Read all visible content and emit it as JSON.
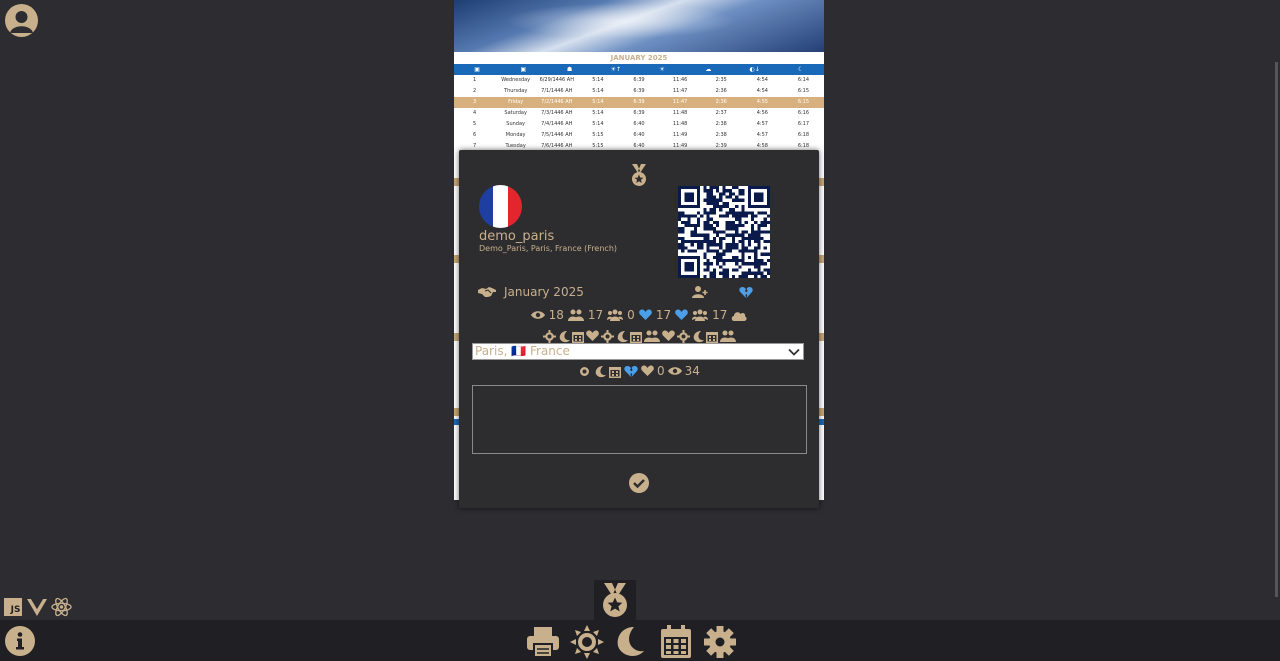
{
  "calendar": {
    "month_title": "JANUARY 2025",
    "headers": [
      "▣",
      "▣",
      "☗",
      "☀↑",
      "☀",
      "☁",
      "◐↓",
      "☾"
    ],
    "rows": [
      [
        "1",
        "Wednesday",
        "6/29/1446 AH",
        "5:14",
        "6:39",
        "11:46",
        "2:35",
        "4:54",
        "6:14"
      ],
      [
        "2",
        "Thursday",
        "7/1/1446 AH",
        "5:14",
        "6:39",
        "11:47",
        "2:36",
        "4:54",
        "6:15"
      ],
      [
        "3",
        "Friday",
        "7/2/1446 AH",
        "5:14",
        "6:39",
        "11:47",
        "2:36",
        "4:55",
        "6:15"
      ],
      [
        "4",
        "Saturday",
        "7/3/1446 AH",
        "5:14",
        "6:39",
        "11:48",
        "2:37",
        "4:56",
        "6:16"
      ],
      [
        "5",
        "Sunday",
        "7/4/1446 AH",
        "5:14",
        "6:40",
        "11:48",
        "2:38",
        "4:57",
        "6:17"
      ],
      [
        "6",
        "Monday",
        "7/5/1446 AH",
        "5:15",
        "6:40",
        "11:49",
        "2:38",
        "4:57",
        "6:18"
      ],
      [
        "7",
        "Tuesday",
        "7/6/1446 AH",
        "5:15",
        "6:40",
        "11:49",
        "2:39",
        "4:58",
        "6:18"
      ]
    ]
  },
  "profile": {
    "username": "demo_paris",
    "subtitle": "Demo_Paris, Paris, France (French)",
    "month": "January 2025"
  },
  "stats": {
    "views": "18",
    "followers": "17",
    "groups": "0",
    "likes": "17",
    "likes2": "17",
    "members": "17"
  },
  "location_select": {
    "value": "Paris, 🇫🇷 France"
  },
  "stats2": {
    "likes": "0",
    "views": "34"
  },
  "colors": {
    "accent": "#c8b08d",
    "modal_bg": "#2d2d2f",
    "page_bg": "#2c2c31",
    "heart_blue": "#4a9fe8",
    "cal_blue": "#1a68b8"
  },
  "icons": {
    "top": "medal-icon",
    "handshake": "handshake-icon",
    "add_user": "user-plus-icon",
    "broken_heart": "heart-broken-icon",
    "confirm": "check-circle-icon",
    "toolbar": [
      "print-icon",
      "sun-icon",
      "moon-icon",
      "calendar-icon",
      "gear-icon"
    ],
    "frameworks": [
      "js-icon",
      "vue-icon",
      "react-icon"
    ]
  }
}
